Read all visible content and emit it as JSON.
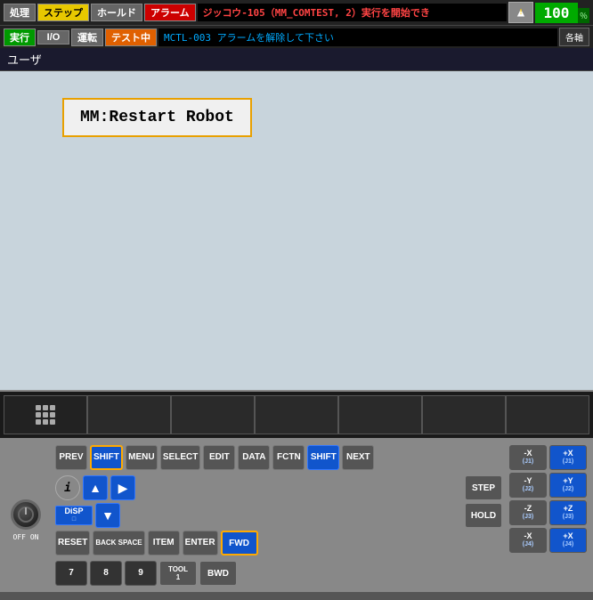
{
  "topbar": {
    "btn1": "処理",
    "btn2": "ステップ",
    "btn3": "ホールド",
    "btn4": "アラーム",
    "alarm_msg": "ジッコウ-105（MM_COMTEST, 2）実行を開始でき",
    "info_symbol": "ⓘ",
    "percent": "100",
    "percent_sign": "％"
  },
  "secondbar": {
    "btn1": "実行",
    "btn2": "I/O",
    "btn3": "運転",
    "btn4": "テスト中",
    "alarm_msg2": "MCTL-003 アラームを解除して下さい",
    "axes_btn": "各軸"
  },
  "userbar": {
    "label": "ユーザ"
  },
  "main": {
    "program_text": "MM:Restart Robot"
  },
  "nav": {
    "btn1": "≡",
    "btn2": "",
    "btn3": "",
    "btn4": "",
    "btn5": "",
    "btn6": "",
    "btn7": ""
  },
  "keyboard": {
    "row1": [
      "PREV",
      "SHIFT",
      "MENU",
      "SELECT",
      "EDIT",
      "DATA",
      "FCTN",
      "SHIFT",
      "NEXT"
    ],
    "step": "STEP",
    "hold": "HOLD",
    "fwd": "FWD",
    "bwd": "BWD",
    "reset": "RESET",
    "backspace": "BACK SPACE",
    "item": "ITEM",
    "enter": "ENTER",
    "num7": "7",
    "num8": "8",
    "num9": "9",
    "tool1": "TOOL 1",
    "info_i": "i",
    "disp": "DiSP",
    "offon": "OFF ON",
    "axis_xn": "-X",
    "axis_xp": "+X",
    "axis_j1": "(J1)",
    "axis_yn": "-Y",
    "axis_yp": "+Y",
    "axis_j2": "(J2)",
    "axis_zn": "-Z",
    "axis_zp": "+Z",
    "axis_j3": "(J3)",
    "axis_xnj4": "-X",
    "axis_xpj4": "+X",
    "axis_j4": "(J4)"
  }
}
